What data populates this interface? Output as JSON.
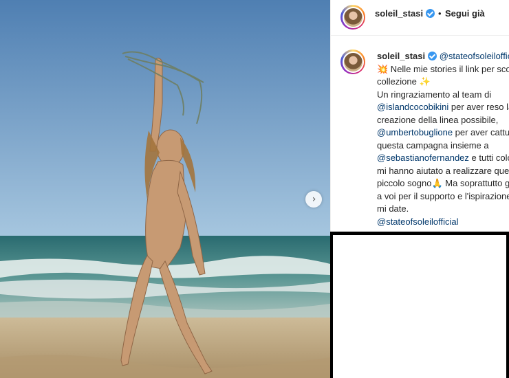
{
  "post": {
    "username": "soleil_stasi",
    "follow_status": "Segui già",
    "dot": "•",
    "caption": {
      "author": "soleil_stasi",
      "tag_head": "@stateofsoleilofficial",
      "lines": [
        {
          "emoji": "💥",
          "text": " Nelle mie stories il link per scoprire la"
        },
        {
          "text": "collezione ",
          "emoji_after": "✨"
        },
        {
          "text": "Un ringraziamento al team di"
        },
        {
          "mention": "@islandcocobikini",
          "text": " per aver reso la"
        },
        {
          "text": "creazione della linea possibile,"
        },
        {
          "mention": "@umbertobuglione",
          "text": " per aver catturato"
        },
        {
          "text": "questa campagna insieme a"
        },
        {
          "mention": "@sebastianofernandez",
          "text": " e tutti coloro che"
        },
        {
          "text": "mi hanno aiutato a realizzare questo"
        },
        {
          "text": "piccolo sogno",
          "emoji_after": "🙏",
          "text2": " Ma soprattutto grazie"
        },
        {
          "text": "a voi per il supporto e l'ispirazione che"
        },
        {
          "text": "mi date."
        },
        {
          "mention": "@stateofsoleilofficial"
        }
      ]
    }
  },
  "carousel": {
    "next_icon": "›"
  }
}
